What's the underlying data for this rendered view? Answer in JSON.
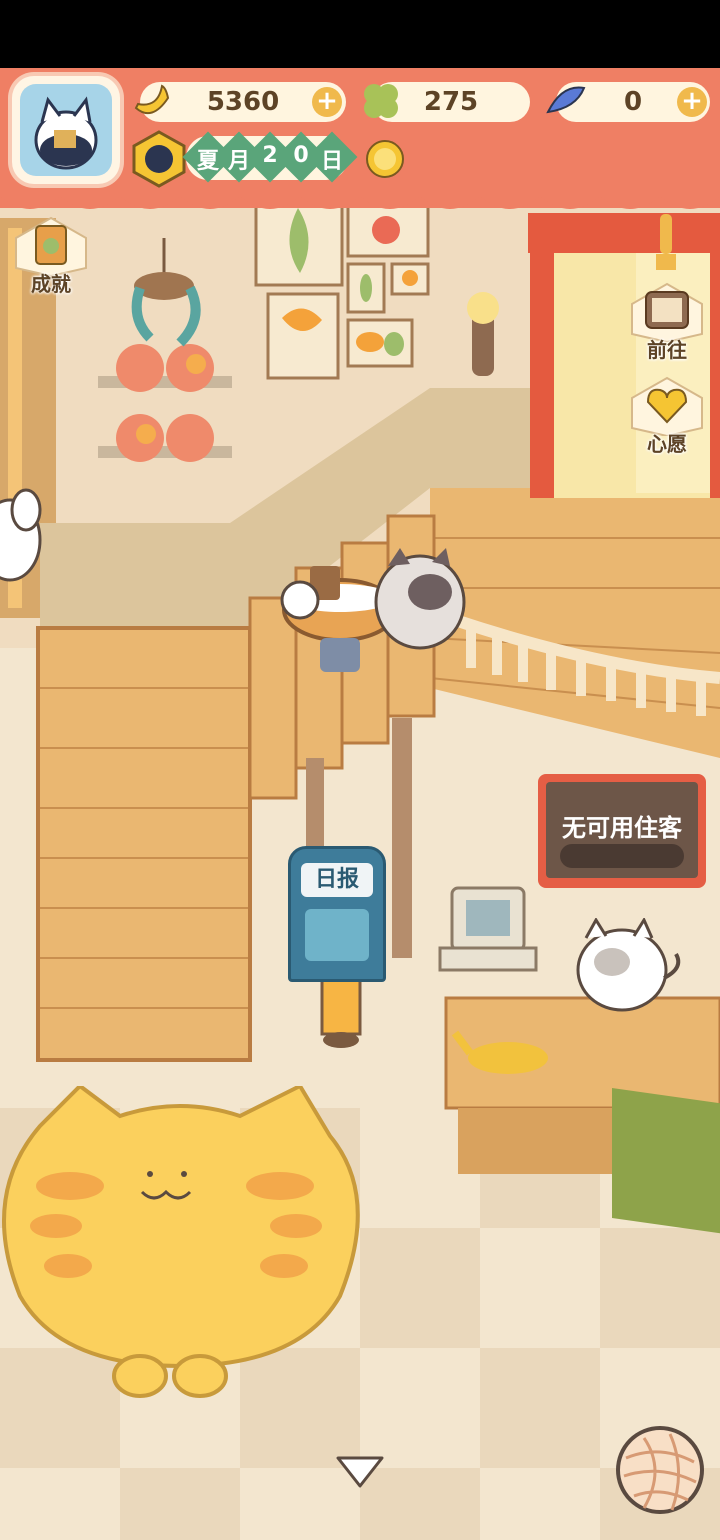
{
  "currency": {
    "bananas": "5360",
    "clovers": "275",
    "fish": "0"
  },
  "date": {
    "season": "夏",
    "month_char": "月",
    "day_1": "2",
    "day_2": "0",
    "day_char": "日"
  },
  "side_buttons": {
    "achievements": "成就",
    "goto": "前往",
    "wish": "心愿"
  },
  "scene": {
    "newspaper": "日报",
    "guest_sign": "无可用住客"
  },
  "colors": {
    "banner": "#ef7f64",
    "date_green": "#5aa57a",
    "wood": "#e9b66e"
  }
}
